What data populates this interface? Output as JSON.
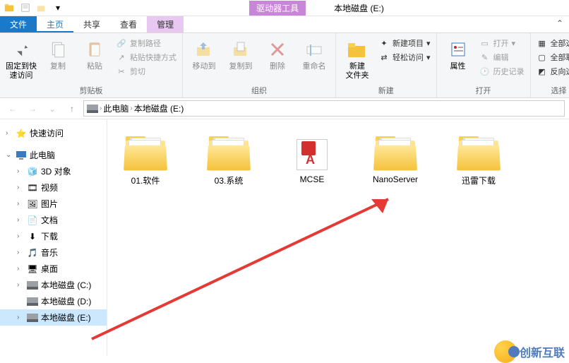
{
  "title": {
    "context_tab": "驱动器工具",
    "location": "本地磁盘 (E:)"
  },
  "tabs": {
    "file": "文件",
    "home": "主页",
    "share": "共享",
    "view": "查看",
    "manage": "管理"
  },
  "ribbon": {
    "clipboard": {
      "pin": "固定到快\n速访问",
      "copy": "复制",
      "paste": "粘贴",
      "copy_path": "复制路径",
      "paste_shortcut": "粘贴快捷方式",
      "cut": "剪切",
      "group": "剪贴板"
    },
    "organize": {
      "move_to": "移动到",
      "copy_to": "复制到",
      "delete": "删除",
      "rename": "重命名",
      "group": "组织"
    },
    "new": {
      "new_folder": "新建\n文件夹",
      "new_item": "新建项目",
      "easy_access": "轻松访问",
      "group": "新建"
    },
    "open": {
      "properties": "属性",
      "open": "打开",
      "edit": "编辑",
      "history": "历史记录",
      "group": "打开"
    },
    "select": {
      "select_all": "全部选择",
      "select_none": "全部取消",
      "invert": "反向选择",
      "group": "选择"
    }
  },
  "breadcrumb": {
    "pc": "此电脑",
    "drive": "本地磁盘 (E:)"
  },
  "tree": {
    "quick": "快速访问",
    "pc": "此电脑",
    "objects3d": "3D 对象",
    "videos": "视频",
    "pictures": "图片",
    "documents": "文档",
    "downloads": "下载",
    "music": "音乐",
    "desktop": "桌面",
    "drive_c": "本地磁盘 (C:)",
    "drive_d": "本地磁盘 (D:)",
    "drive_e": "本地磁盘 (E:)"
  },
  "folders": [
    {
      "name": "01.软件",
      "type": "folder"
    },
    {
      "name": "03.系统",
      "type": "folder"
    },
    {
      "name": "MCSE",
      "type": "pdf-folder"
    },
    {
      "name": "NanoServer",
      "type": "folder"
    },
    {
      "name": "迅雷下载",
      "type": "folder"
    }
  ],
  "watermark": "创新互联"
}
